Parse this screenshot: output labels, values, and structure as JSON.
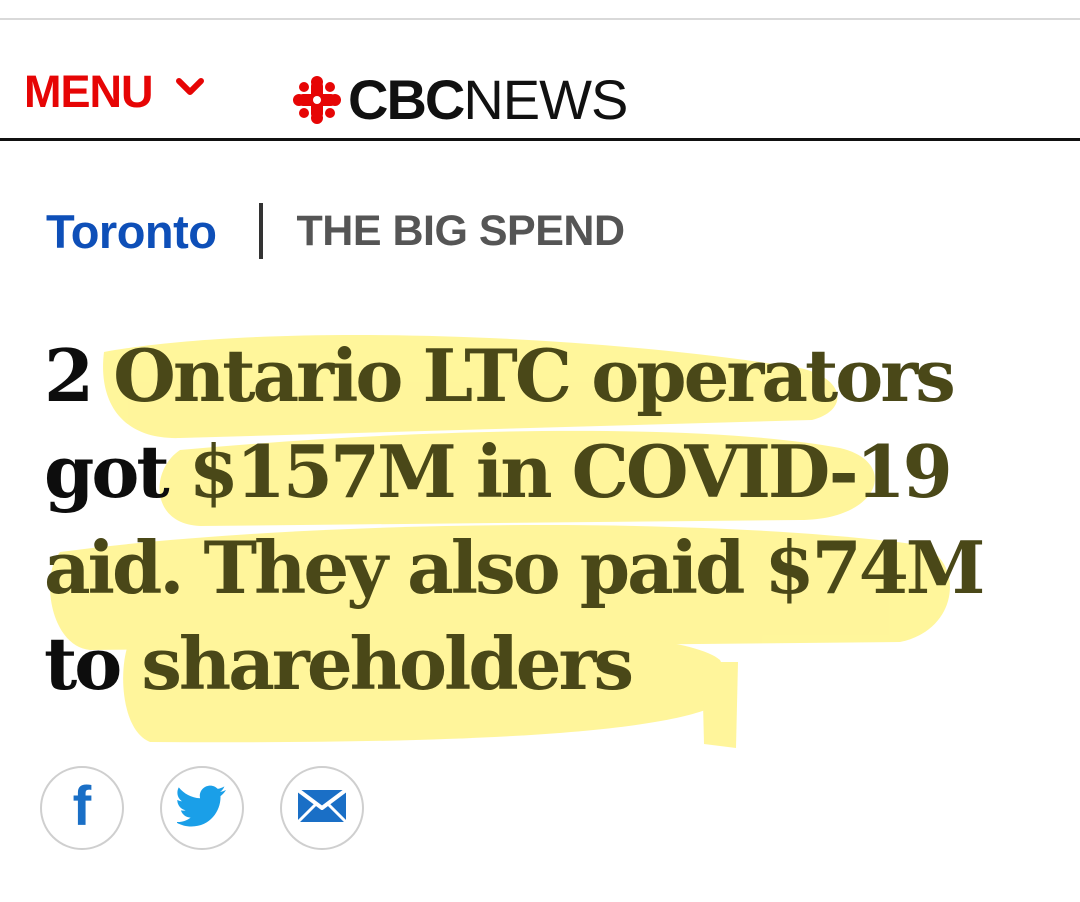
{
  "header": {
    "menu_label": "MENU",
    "logo": {
      "brand": "CBC",
      "product": "NEWS"
    }
  },
  "breadcrumb": {
    "region": "Toronto",
    "series": "THE BIG SPEND"
  },
  "article": {
    "headline": {
      "line1_pre": "2 ",
      "line1_hl": "Ontario LTC operators",
      "line2_pre": "got ",
      "line2_hl": "$157M in COVID-19",
      "line3_hl": "aid. They also paid $74M",
      "line4_pre": "to ",
      "line4_hl": "shareholders"
    }
  },
  "share": {
    "icons": [
      "facebook-icon",
      "twitter-icon",
      "email-icon"
    ]
  },
  "colors": {
    "cbc_red": "#e60505",
    "link_blue": "#0e4fb8",
    "series_gray": "#555555",
    "headline_text": "#0d0d0d",
    "highlighter": "#fff48a",
    "social_blue": "#1a6fc6"
  }
}
